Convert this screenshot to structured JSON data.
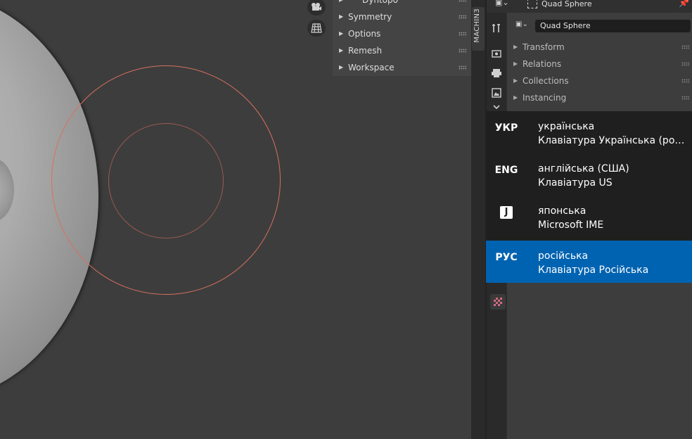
{
  "npanel": {
    "rows": [
      "Dyntopo",
      "Symmetry",
      "Options",
      "Remesh",
      "Workspace"
    ],
    "tab_label": "MACHIN3"
  },
  "properties": {
    "header_title": "Quad Sphere",
    "object_name": "Quad Sphere",
    "sections": [
      "Transform",
      "Relations",
      "Collections",
      "Instancing"
    ]
  },
  "input_switcher": {
    "items": [
      {
        "code": "УКР",
        "name": "українська",
        "layout": "Клавіатура Українська (розширена)"
      },
      {
        "code": "ENG",
        "name": "англійська (США)",
        "layout": "Клавіатура US"
      },
      {
        "code": "J",
        "name": "японська",
        "layout": "Microsoft IME"
      },
      {
        "code": "РУС",
        "name": "російська",
        "layout": "Клавіатура Російська",
        "selected": true
      }
    ],
    "selected_color": "#0063b1"
  },
  "icons": {
    "camera": "camera-icon",
    "grid": "grid-icon",
    "tool": "tool-icon",
    "render": "render-icon",
    "output": "output-icon",
    "view_layer": "view-layer-icon",
    "scene": "scene-icon",
    "texture": "texture-icon",
    "pin": "pin-icon"
  }
}
